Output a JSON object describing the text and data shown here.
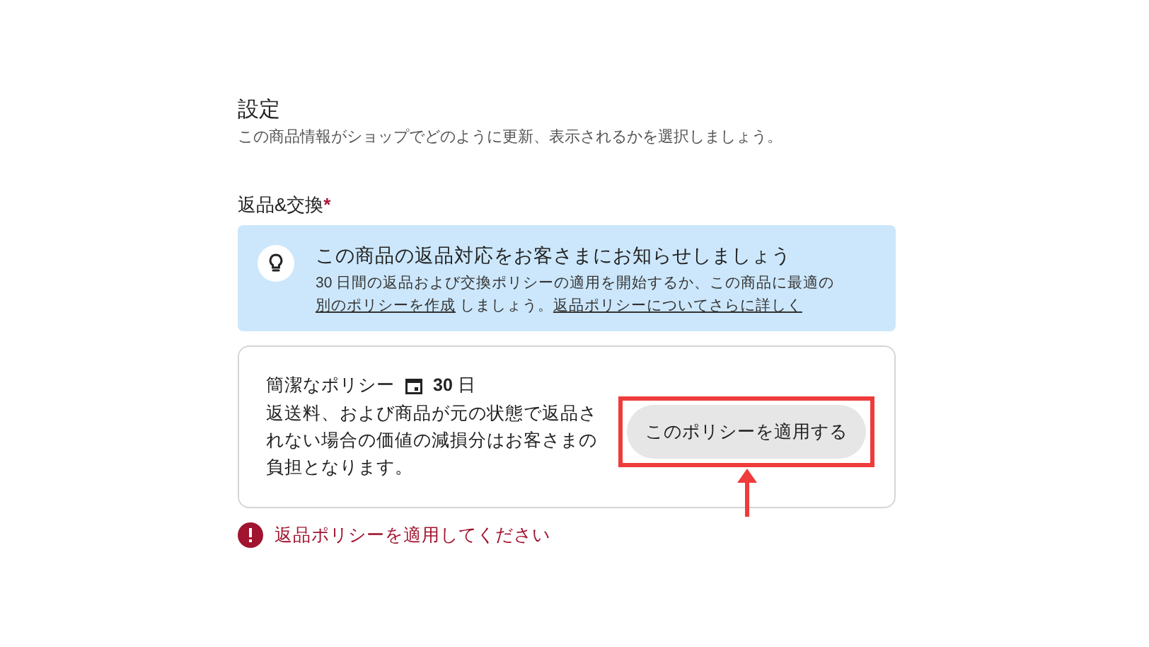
{
  "settings": {
    "title": "設定",
    "description": "この商品情報がショップでどのように更新、表示されるかを選択しましょう。"
  },
  "returns": {
    "label": "返品&交換",
    "required_mark": "*",
    "notice": {
      "title": "この商品の返品対応をお客さまにお知らせしましょう",
      "text_1": "30 日間の返品および交換ポリシーの適用を開始するか、この商品に最適の",
      "link_1": "別のポリシーを作成",
      "text_2": " しましょう。",
      "link_2": "返品ポリシーについてさらに詳しく"
    },
    "policy": {
      "name": "簡潔なポリシー",
      "days": "**30** 日",
      "description": "返送料、および商品が元の状態で返品されない場合の価値の減損分はお客さまの負担となります。",
      "button": "このポリシーを適用する",
      "highlighted": true
    },
    "error": "返品ポリシーを適用してください"
  }
}
